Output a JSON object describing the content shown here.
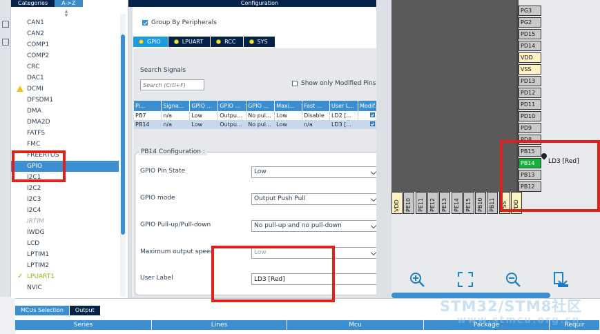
{
  "colors": {
    "header_dark": "#03234b",
    "accent": "#3b8fd1",
    "selected_pin": "#13b33b",
    "annotation_red": "#e0201a"
  },
  "categories": {
    "tabs": [
      {
        "label": "Categories"
      },
      {
        "label": "A->Z"
      }
    ],
    "items": [
      {
        "label": "CAN1",
        "state": "normal"
      },
      {
        "label": "CAN2",
        "state": "normal"
      },
      {
        "label": "COMP1",
        "state": "normal"
      },
      {
        "label": "COMP2",
        "state": "normal"
      },
      {
        "label": "CRC",
        "state": "normal"
      },
      {
        "label": "DAC1",
        "state": "normal"
      },
      {
        "label": "DCMI",
        "state": "warning"
      },
      {
        "label": "DFSDM1",
        "state": "normal"
      },
      {
        "label": "DMA",
        "state": "normal"
      },
      {
        "label": "DMA2D",
        "state": "normal"
      },
      {
        "label": "FATFS",
        "state": "normal"
      },
      {
        "label": "FMC",
        "state": "normal"
      },
      {
        "label": "FREERTOS",
        "state": "normal"
      },
      {
        "label": "GPIO",
        "state": "selected"
      },
      {
        "label": "I2C1",
        "state": "normal"
      },
      {
        "label": "I2C2",
        "state": "normal"
      },
      {
        "label": "I2C3",
        "state": "normal"
      },
      {
        "label": "I2C4",
        "state": "normal"
      },
      {
        "label": "IRTIM",
        "state": "disabled"
      },
      {
        "label": "IWDG",
        "state": "normal"
      },
      {
        "label": "LCD",
        "state": "normal"
      },
      {
        "label": "LPTIM1",
        "state": "normal"
      },
      {
        "label": "LPTIM2",
        "state": "normal"
      },
      {
        "label": "LPUART1",
        "state": "configured"
      },
      {
        "label": "NVIC",
        "state": "normal"
      }
    ]
  },
  "config": {
    "title": "Configuration",
    "group_by_label": "Group By Peripherals",
    "group_by_checked": true,
    "tabs": [
      {
        "label": "GPIO",
        "active": true
      },
      {
        "label": "LPUART",
        "active": false
      },
      {
        "label": "RCC",
        "active": false
      },
      {
        "label": "SYS",
        "active": false
      }
    ],
    "search": {
      "label": "Search Signals",
      "placeholder": "Search (Crtl+F)"
    },
    "show_modified_label": "Show only Modified Pins",
    "show_modified_checked": false,
    "table": {
      "headers": [
        "Pi...",
        "Signa...",
        "GPIO ...",
        "GPIO ...",
        "GPIO ...",
        "Maxi...",
        "Fast ...",
        "User L...",
        "Modif..."
      ],
      "rows": [
        [
          "PB7",
          "n/a",
          "Low",
          "Outpu...",
          "No pul...",
          "Low",
          "Disable",
          "LD2 [...",
          ""
        ],
        [
          "PB14",
          "n/a",
          "Low",
          "Outpu...",
          "No pul...",
          "Low",
          "n/a",
          "LD3 [...",
          ""
        ]
      ]
    },
    "pin_config": {
      "title": "PB14 Configuration :",
      "fields": [
        {
          "label": "GPIO Pin State",
          "value": "Low"
        },
        {
          "label": "GPIO mode",
          "value": "Output Push Pull"
        },
        {
          "label": "GPIO Pull-up/Pull-down",
          "value": "No pull-up and no pull-down"
        },
        {
          "label": "Maximum output speed",
          "value": "Low"
        },
        {
          "label": "User Label",
          "value": "LD3 [Red]"
        }
      ]
    }
  },
  "chip": {
    "right_pins": [
      {
        "label": "PG3",
        "color": "gray"
      },
      {
        "label": "PG2",
        "color": "gray"
      },
      {
        "label": "PD15",
        "color": "gray"
      },
      {
        "label": "PD14",
        "color": "gray"
      },
      {
        "label": "VDD",
        "color": "yellow"
      },
      {
        "label": "VSS",
        "color": "yellow"
      },
      {
        "label": "PD13",
        "color": "gray"
      },
      {
        "label": "PD12",
        "color": "gray"
      },
      {
        "label": "PD11",
        "color": "gray"
      },
      {
        "label": "PD10",
        "color": "gray"
      },
      {
        "label": "PD9",
        "color": "gray"
      },
      {
        "label": "PD8",
        "color": "gray"
      },
      {
        "label": "PB15",
        "color": "gray"
      },
      {
        "label": "PB14",
        "color": "green"
      },
      {
        "label": "PB13",
        "color": "gray"
      },
      {
        "label": "PB12",
        "color": "gray"
      }
    ],
    "bottom_pins": [
      {
        "label": "VDD",
        "color": "yellow"
      },
      {
        "label": "PE10",
        "color": "gray"
      },
      {
        "label": "PE11",
        "color": "gray"
      },
      {
        "label": "PE12",
        "color": "gray"
      },
      {
        "label": "PE13",
        "color": "gray"
      },
      {
        "label": "PE14",
        "color": "gray"
      },
      {
        "label": "PE15",
        "color": "gray"
      },
      {
        "label": "PB10",
        "color": "gray"
      },
      {
        "label": "PB11",
        "color": "gray"
      },
      {
        "label": "VSS",
        "color": "yellow"
      },
      {
        "label": "VDD",
        "color": "yellow"
      }
    ],
    "selected_pin_label": "LD3 [Red]",
    "tools": [
      "zoom-in-icon",
      "fit-screen-icon",
      "zoom-out-icon",
      "export-icon"
    ]
  },
  "bottom": {
    "tabs": [
      {
        "label": "MCUs Selection",
        "active": false
      },
      {
        "label": "Output",
        "active": true
      }
    ],
    "columns": [
      "Series",
      "Lines",
      "Mcu",
      "Package",
      "Requir"
    ]
  },
  "watermark": {
    "line1": "STM32/STM8社区",
    "line2": "www.stmcu.org.cn"
  }
}
